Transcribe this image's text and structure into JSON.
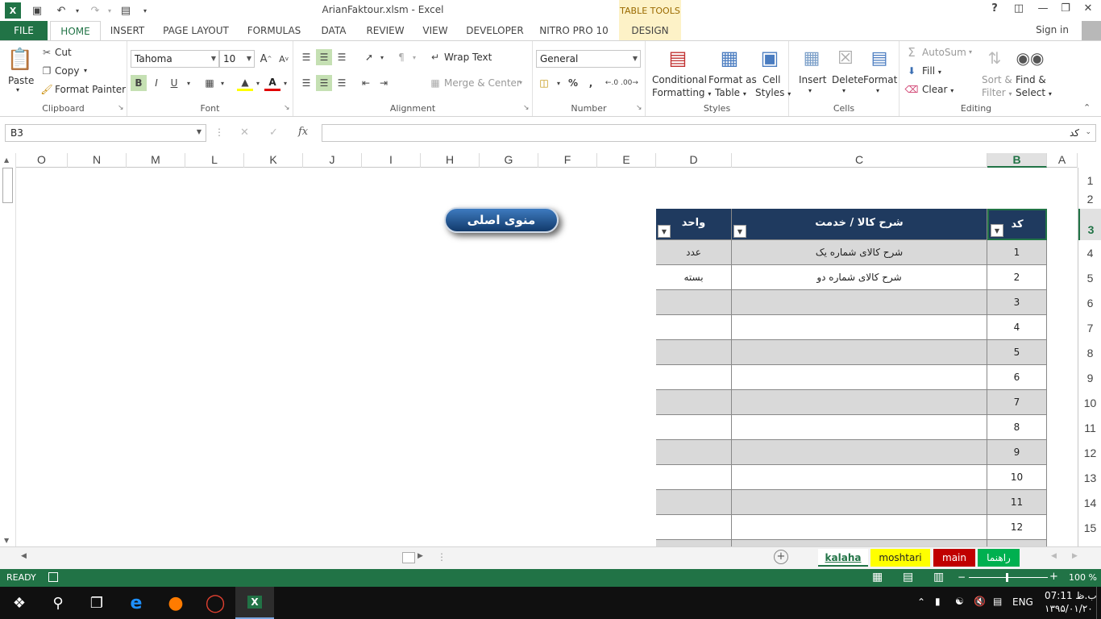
{
  "titlebar": {
    "title": "ArianFaktour.xlsm - Excel",
    "context_title": "TABLE TOOLS",
    "help": "?"
  },
  "tabs": [
    "FILE",
    "HOME",
    "INSERT",
    "PAGE LAYOUT",
    "FORMULAS",
    "DATA",
    "REVIEW",
    "VIEW",
    "DEVELOPER",
    "NITRO PRO 10",
    "DESIGN"
  ],
  "signin": "Sign in",
  "ribbon": {
    "clipboard": {
      "paste": "Paste",
      "cut": "Cut",
      "copy": "Copy",
      "format_painter": "Format Painter",
      "label": "Clipboard"
    },
    "font": {
      "name": "Tahoma",
      "size": "10",
      "bold": "B",
      "italic": "I",
      "underline": "U",
      "grow": "A",
      "shrink": "A",
      "label": "Font"
    },
    "alignment": {
      "wrap": "Wrap Text",
      "merge": "Merge & Center",
      "label": "Alignment"
    },
    "number": {
      "format": "General",
      "percent": "%",
      "comma": ",",
      "label": "Number"
    },
    "styles": {
      "cond_1": "Conditional",
      "cond_2": "Formatting",
      "fmt_1": "Format as",
      "fmt_2": "Table",
      "cell_1": "Cell",
      "cell_2": "Styles",
      "label": "Styles"
    },
    "cells": {
      "insert": "Insert",
      "delete": "Delete",
      "format": "Format",
      "label": "Cells"
    },
    "editing": {
      "autosum": "AutoSum",
      "fill": "Fill",
      "clear": "Clear",
      "sort_1": "Sort &",
      "sort_2": "Filter",
      "find_1": "Find &",
      "find_2": "Select",
      "label": "Editing"
    }
  },
  "formula_bar": {
    "name_box": "B3",
    "fx": "fx",
    "value": "کد"
  },
  "columns": [
    "O",
    "N",
    "M",
    "L",
    "K",
    "J",
    "I",
    "H",
    "G",
    "F",
    "E",
    "D",
    "C",
    "B",
    "A"
  ],
  "rows": [
    "1",
    "2",
    "3",
    "4",
    "5",
    "6",
    "7",
    "8",
    "9",
    "10",
    "11",
    "12",
    "13",
    "14",
    "15"
  ],
  "menu_button": "منوی اصلی",
  "table": {
    "headers": {
      "code": "کد",
      "desc": "شرح کالا / خدمت",
      "unit": "واحد"
    },
    "rows": [
      {
        "code": "1",
        "desc": "شرح کالای شماره یک",
        "unit": "عدد"
      },
      {
        "code": "2",
        "desc": "شرح کالای شماره دو",
        "unit": "بسته"
      },
      {
        "code": "3",
        "desc": "",
        "unit": ""
      },
      {
        "code": "4",
        "desc": "",
        "unit": ""
      },
      {
        "code": "5",
        "desc": "",
        "unit": ""
      },
      {
        "code": "6",
        "desc": "",
        "unit": ""
      },
      {
        "code": "7",
        "desc": "",
        "unit": ""
      },
      {
        "code": "8",
        "desc": "",
        "unit": ""
      },
      {
        "code": "9",
        "desc": "",
        "unit": ""
      },
      {
        "code": "10",
        "desc": "",
        "unit": ""
      },
      {
        "code": "11",
        "desc": "",
        "unit": ""
      },
      {
        "code": "12",
        "desc": "",
        "unit": ""
      }
    ]
  },
  "sheets": [
    {
      "name": "kalaha",
      "bg": "#e8f0e0",
      "fg": "#217346"
    },
    {
      "name": "moshtari",
      "bg": "#ffff00",
      "fg": "#222222"
    },
    {
      "name": "main",
      "bg": "#c00000",
      "fg": "#ffffff"
    },
    {
      "name": "راهنما",
      "bg": "#00b050",
      "fg": "#ffffff"
    }
  ],
  "status": {
    "ready": "READY",
    "zoom": "100 %"
  },
  "taskbar": {
    "lang": "ENG",
    "time": "07:11 ب.ظ",
    "date": "۱۳۹۵/۰۱/۲۰"
  },
  "colors": {
    "excel_green": "#217346",
    "table_header": "#1f3a5f",
    "band": "#d9d9d9"
  }
}
